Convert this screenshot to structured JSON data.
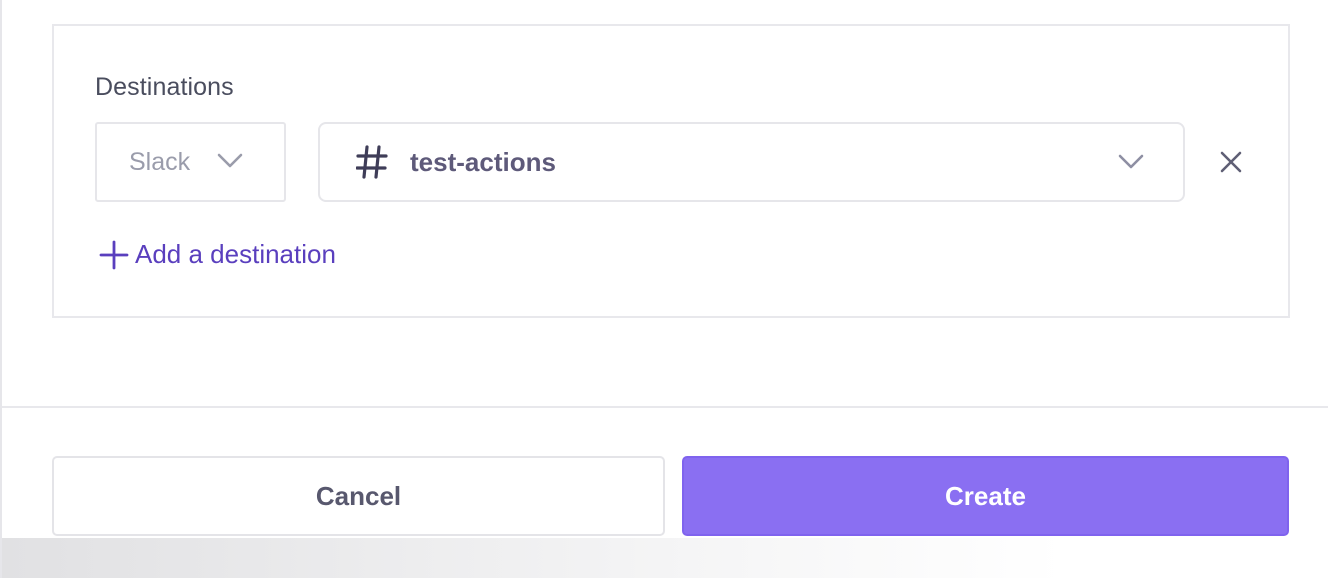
{
  "destinations": {
    "label": "Destinations",
    "provider": {
      "value": "Slack",
      "icon": "chevron-down-icon"
    },
    "channel": {
      "value": "test-actions",
      "prefix_icon": "hash-icon",
      "icon": "chevron-down-icon"
    },
    "remove_icon": "close-icon",
    "add_label": "Add a destination",
    "add_icon": "plus-icon"
  },
  "footer": {
    "cancel_label": "Cancel",
    "create_label": "Create"
  },
  "colors": {
    "accent": "#8a6ff2",
    "link": "#5a3fbe",
    "text_muted": "#9a9cab",
    "text_dark": "#4a4d5e"
  }
}
